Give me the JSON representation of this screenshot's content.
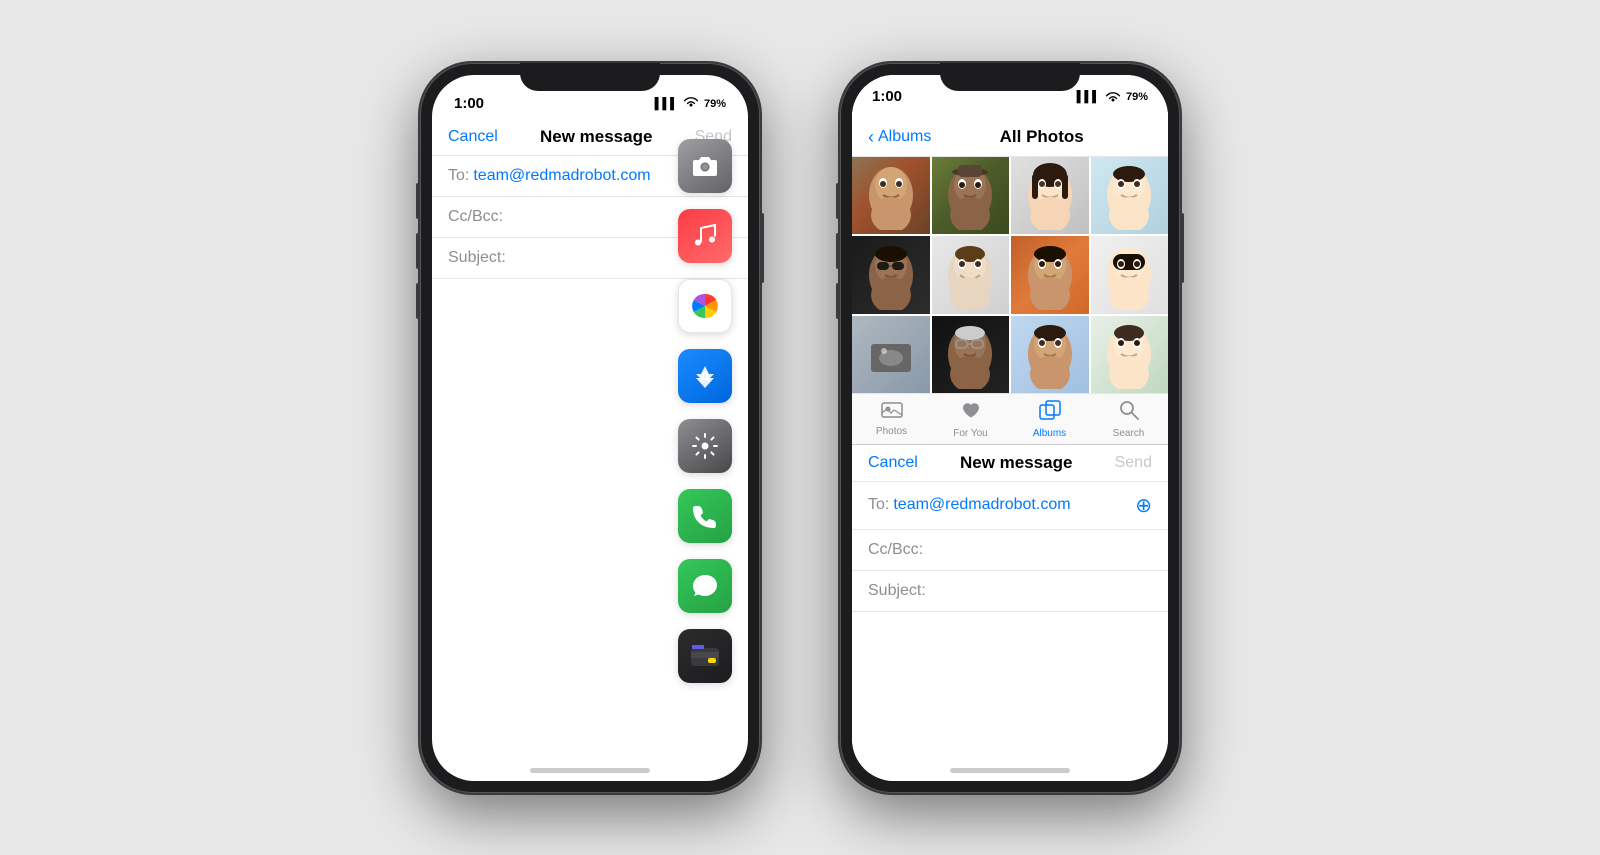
{
  "page": {
    "background": "#e8e8e8"
  },
  "left_phone": {
    "status": {
      "time": "1:00",
      "signal": "▌▌▌",
      "wifi": "WiFi",
      "battery": "79%"
    },
    "nav": {
      "cancel": "Cancel",
      "title": "New message",
      "send": "Send"
    },
    "fields": {
      "to_label": "To:",
      "to_value": "team@redmadrobot.com",
      "cc_label": "Cc/Bcc:",
      "subject_label": "Subject:"
    },
    "apps": [
      {
        "name": "camera",
        "emoji": "📷",
        "class": "icon-camera"
      },
      {
        "name": "music",
        "emoji": "♪",
        "class": "icon-music"
      },
      {
        "name": "photos",
        "emoji": "🌸",
        "class": "icon-photos"
      },
      {
        "name": "appstore",
        "emoji": "A",
        "class": "icon-appstore"
      },
      {
        "name": "settings",
        "emoji": "⚙",
        "class": "icon-settings"
      },
      {
        "name": "phone",
        "emoji": "📞",
        "class": "icon-phone"
      },
      {
        "name": "messages",
        "emoji": "💬",
        "class": "icon-messages"
      },
      {
        "name": "wallet",
        "emoji": "💳",
        "class": "icon-wallet"
      }
    ]
  },
  "right_phone": {
    "status": {
      "time": "1:00",
      "signal": "▌▌▌",
      "wifi": "WiFi",
      "battery": "79%"
    },
    "photos_nav": {
      "back": "Albums",
      "title": "All Photos"
    },
    "tab_bar": [
      {
        "id": "photos",
        "label": "Photos",
        "active": false
      },
      {
        "id": "for-you",
        "label": "For You",
        "active": false
      },
      {
        "id": "albums",
        "label": "Albums",
        "active": true
      },
      {
        "id": "search",
        "label": "Search",
        "active": false
      }
    ],
    "mail_nav": {
      "cancel": "Cancel",
      "title": "New message",
      "send": "Send"
    },
    "mail_fields": {
      "to_label": "To:",
      "to_value": "team@redmadrobot.com",
      "cc_label": "Cc/Bcc:",
      "subject_label": "Subject:"
    }
  }
}
